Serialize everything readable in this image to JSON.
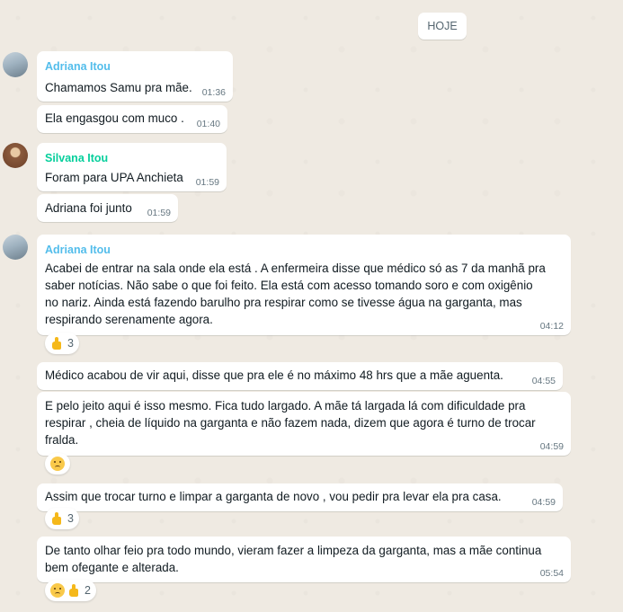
{
  "date_chip": "HOJE",
  "colors": {
    "adriana": "#53bdeb",
    "silvana": "#06cf9c"
  },
  "messages": [
    {
      "sender": "Adriana Itou",
      "text": "Chamamos Samu pra mãe.",
      "time": "01:36"
    },
    {
      "text": "Ela engasgou com muco .",
      "time": "01:40"
    },
    {
      "sender": "Silvana Itou",
      "text": "Foram para UPA Anchieta",
      "time": "01:59"
    },
    {
      "text": "Adriana foi junto",
      "time": "01:59"
    },
    {
      "sender": "Adriana Itou",
      "text": "Acabei de entrar na sala onde ela está . A enfermeira disse que médico só as 7 da manhã pra saber notícias. Não sabe o que foi feito. Ela está com acesso tomando soro e com oxigênio no nariz. Ainda está fazendo barulho pra respirar como se tivesse água na garganta, mas respirando serenamente agora.",
      "time": "04:12",
      "reaction": {
        "emojis": [
          "thumbs-up"
        ],
        "count": "3"
      }
    },
    {
      "text": "Médico acabou de vir aqui, disse que pra ele é no máximo 48 hrs que a mãe aguenta.",
      "time": "04:55"
    },
    {
      "text": "E pelo jeito aqui é isso mesmo. Fica tudo largado. A mãe tá largada lá com dificuldade pra respirar , cheia de líquido na garganta e não fazem nada, dizem que agora é turno de trocar fralda.",
      "time": "04:59",
      "reaction": {
        "emojis": [
          "sad-face"
        ],
        "count": ""
      }
    },
    {
      "text": "Assim que trocar turno e limpar a garganta de novo , vou pedir pra levar ela pra casa.",
      "time": "04:59",
      "reaction": {
        "emojis": [
          "thumbs-up"
        ],
        "count": "3"
      }
    },
    {
      "text": "De tanto olhar feio pra todo mundo, vieram fazer a limpeza da garganta, mas a mãe continua bem ofegante e alterada.",
      "time": "05:54",
      "reaction": {
        "emojis": [
          "sad-face",
          "thumbs-up"
        ],
        "count": "2"
      }
    }
  ]
}
